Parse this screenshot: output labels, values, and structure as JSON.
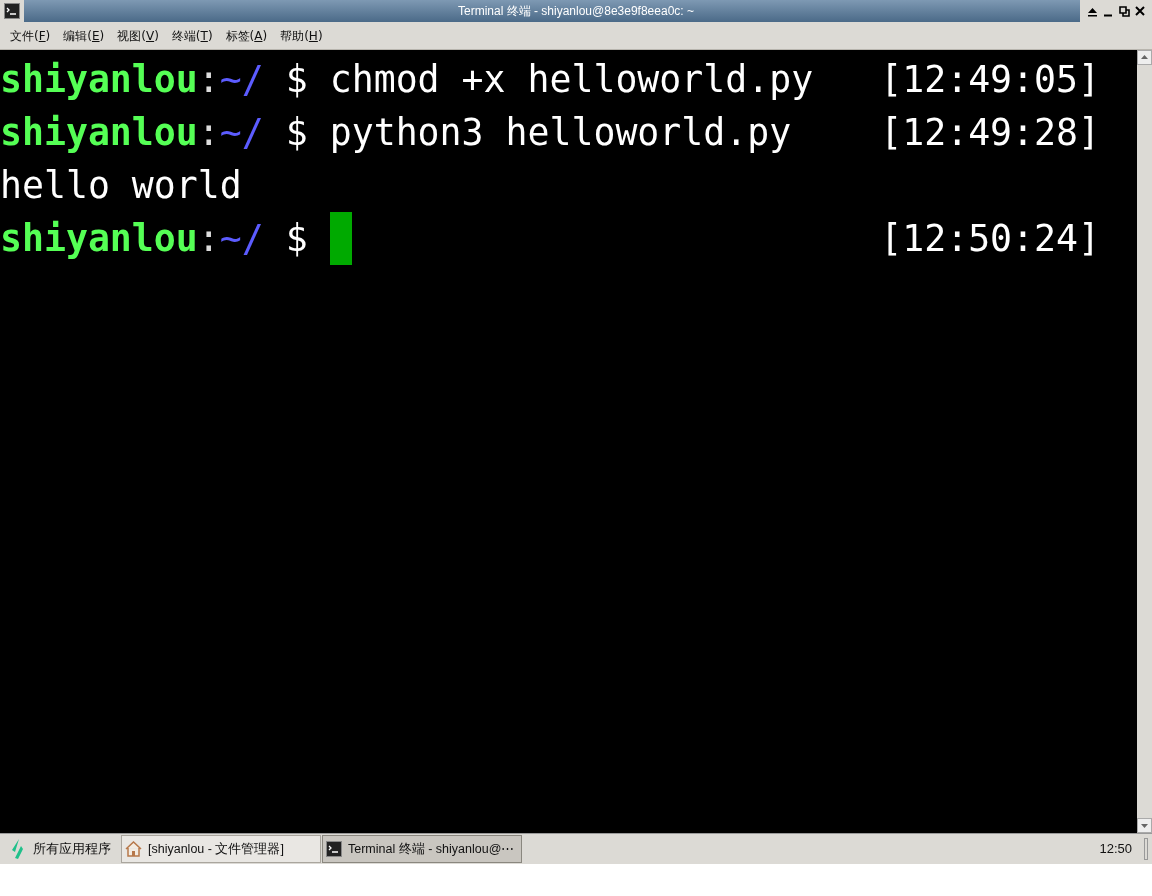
{
  "window": {
    "title": "Terminal 终端 - shiyanlou@8e3e9f8eea0c: ~"
  },
  "menu": [
    {
      "label": "文件(F)"
    },
    {
      "label": "编辑(E)"
    },
    {
      "label": "视图(V)"
    },
    {
      "label": "终端(T)"
    },
    {
      "label": "标签(A)"
    },
    {
      "label": "帮助(H)"
    }
  ],
  "terminal": {
    "lines": [
      {
        "kind": "prompt",
        "user": "shiyanlou",
        "sep": ":",
        "path": "~/",
        "symbol": "$",
        "command": "chmod +x helloworld.py",
        "time": "[12:49:05]",
        "cursor": false
      },
      {
        "kind": "prompt",
        "user": "shiyanlou",
        "sep": ":",
        "path": "~/",
        "symbol": "$",
        "command": "python3 helloworld.py",
        "time": "[12:49:28]",
        "cursor": false
      },
      {
        "kind": "output",
        "text": "hello world"
      },
      {
        "kind": "prompt",
        "user": "shiyanlou",
        "sep": ":",
        "path": "~/",
        "symbol": "$",
        "time": "[12:50:24]",
        "cursor": true
      }
    ]
  },
  "taskbar": {
    "start": "所有应用程序",
    "tasks": [
      {
        "kind": "folder",
        "label": "[shiyanlou - 文件管理器]",
        "selected": false
      },
      {
        "kind": "terminal",
        "label": "Terminal 终端 - shiyanlou@⋯",
        "selected": true
      }
    ],
    "clock": "12:50"
  }
}
